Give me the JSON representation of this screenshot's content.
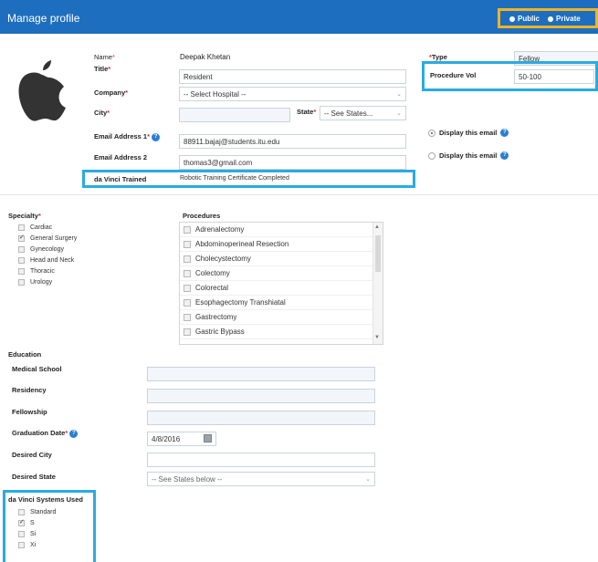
{
  "header": {
    "title": "Manage profile",
    "visibility": {
      "public_label": "Public",
      "private_label": "Private",
      "selected": "Public"
    }
  },
  "avatar_icon": "apple-icon",
  "profile": {
    "name_label": "Name",
    "name_value": "Deepak Khetan",
    "title_label": "Title",
    "title_value": "Resident",
    "company_label": "Company",
    "company_value": "-- Select Hospital --",
    "city_label": "City",
    "city_value": "",
    "state_label": "State",
    "state_value": "-- See States...",
    "email1_label": "Email Address 1",
    "email1_value": "88911.bajaj@students.itu.edu",
    "email2_label": "Email Address 2",
    "email2_value": "thomas3@gmail.com",
    "davinci_trained_label": "da Vinci Trained",
    "davinci_trained_value": "Robotic Training Certificate Completed",
    "display_email1_label": "Display this email",
    "display_email2_label": "Display this email",
    "type_label": "Type",
    "type_value": "Fellow",
    "procedure_vol_label": "Procedure Vol",
    "procedure_vol_value": "50-100"
  },
  "specialty": {
    "label": "Specialty",
    "items": [
      {
        "label": "Cardiac",
        "checked": false
      },
      {
        "label": "General Surgery",
        "checked": true
      },
      {
        "label": "Gynecology",
        "checked": false
      },
      {
        "label": "Head and Neck",
        "checked": false
      },
      {
        "label": "Thoracic",
        "checked": false
      },
      {
        "label": "Urology",
        "checked": false
      }
    ]
  },
  "procedures": {
    "label": "Procedures",
    "items": [
      "Adrenalectomy",
      "Abdominoperineal Resection",
      "Cholecystectomy",
      "Colectomy",
      "Colorectal",
      "Esophagectomy Transhiatal",
      "Gastrectomy",
      "Gastric Bypass"
    ]
  },
  "education": {
    "section_label": "Education",
    "medical_school_label": "Medical School",
    "residency_label": "Residency",
    "fellowship_label": "Fellowship",
    "graduation_label": "Graduation Date",
    "graduation_value": "4/8/2016",
    "desired_city_label": "Desired City",
    "desired_state_label": "Desired State",
    "desired_state_value": "-- See States below --"
  },
  "systems": {
    "label": "da Vinci Systems Used",
    "items": [
      {
        "label": "Standard",
        "checked": false
      },
      {
        "label": "S",
        "checked": true
      },
      {
        "label": "Si",
        "checked": false
      },
      {
        "label": "Xi",
        "checked": false
      }
    ]
  },
  "colors": {
    "header_bg": "#1e6ebf",
    "highlight_blue": "#29abe2",
    "highlight_orange": "#f0b323",
    "required_red": "#c0392b"
  }
}
